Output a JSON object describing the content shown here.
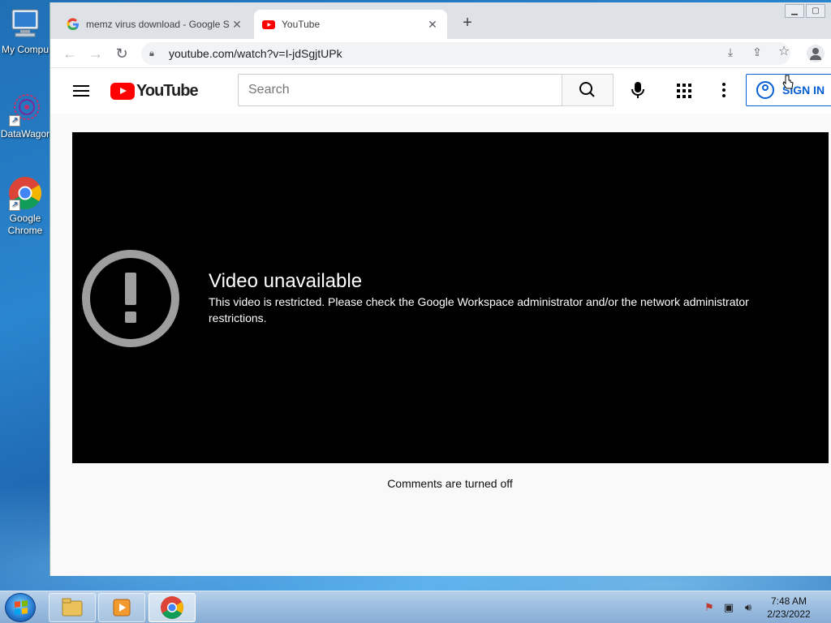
{
  "desktop": {
    "icons": [
      {
        "label": "My Compu"
      },
      {
        "label": "DataWagor"
      },
      {
        "label": "Google Chrome"
      }
    ]
  },
  "browser": {
    "tabs": [
      {
        "title": "memz virus download - Google S",
        "favicon": "google-g-icon",
        "active": false
      },
      {
        "title": "YouTube",
        "favicon": "youtube-icon",
        "active": true
      }
    ],
    "address": "youtube.com/watch?v=I-jdSgjtUPk"
  },
  "youtube": {
    "logo_text": "YouTube",
    "search_placeholder": "Search",
    "sign_in_label": "SIGN IN",
    "error_title": "Video unavailable",
    "error_message": "This video is restricted. Please check the Google Workspace administrator and/or the network administrator restrictions.",
    "comments_status": "Comments are turned off"
  },
  "taskbar": {
    "time": "7:48 AM",
    "date": "2/23/2022"
  },
  "colors": {
    "youtube_red": "#ff0000",
    "link_blue": "#065fd4"
  }
}
